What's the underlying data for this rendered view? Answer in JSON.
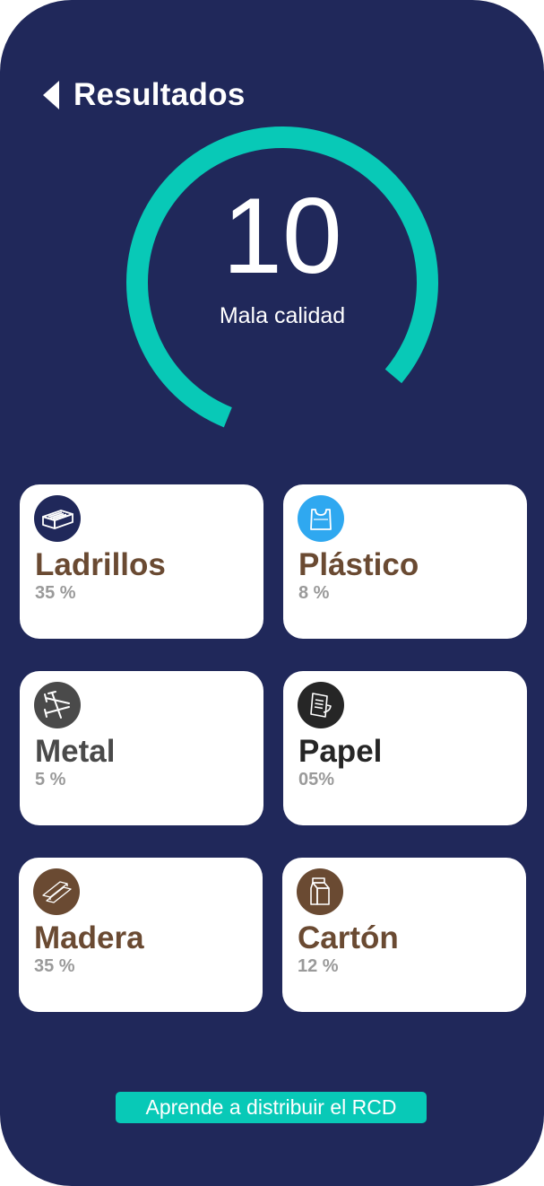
{
  "header": {
    "title": "Resultados"
  },
  "score": {
    "value": "10",
    "label": "Mala calidad",
    "ring_fill_fraction": 0.8,
    "ring_color": "#08c9b7"
  },
  "colors": {
    "background": "#20285a",
    "card": "#ffffff",
    "brown": "#6a4a32",
    "dark": "#3a3a3a",
    "muted": "#9a9a9a",
    "accent": "#08c9b7"
  },
  "materials": [
    {
      "name": "Ladrillos",
      "percent": "35 %",
      "icon": "brick-icon",
      "icon_bg": "#20285a",
      "name_color": "#6a4a32"
    },
    {
      "name": "Plástico",
      "percent": "8 %",
      "icon": "plastic-bag-icon",
      "icon_bg": "#2fa8f0",
      "name_color": "#6a4a32"
    },
    {
      "name": "Metal",
      "percent": "5 %",
      "icon": "nails-icon",
      "icon_bg": "#4a4a4a",
      "name_color": "#4a4a4a"
    },
    {
      "name": "Papel",
      "percent": "05%",
      "icon": "paper-icon",
      "icon_bg": "#262626",
      "name_color": "#262626"
    },
    {
      "name": "Madera",
      "percent": "35 %",
      "icon": "wood-planks-icon",
      "icon_bg": "#6a4a32",
      "name_color": "#6a4a32"
    },
    {
      "name": "Cartón",
      "percent": "12 %",
      "icon": "carton-icon",
      "icon_bg": "#6a4a32",
      "name_color": "#6a4a32"
    }
  ],
  "cta": {
    "label": "Aprende a distribuir el RCD"
  }
}
